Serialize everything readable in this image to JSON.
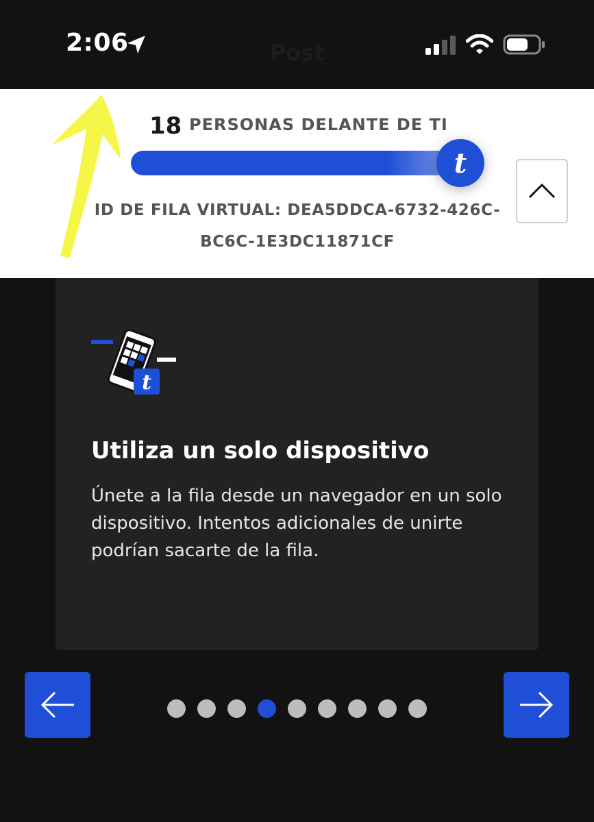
{
  "status_bar": {
    "time": "2:06",
    "ghost_title": "Post",
    "icons": [
      "location-arrow-icon",
      "cellular-signal-icon",
      "wifi-icon",
      "battery-icon"
    ]
  },
  "queue": {
    "ahead_count": "18",
    "ahead_label": "PERSONAS DELANTE DE TI",
    "progress_fraction": 0.97,
    "knob_glyph": "t",
    "id_text": "ID DE FILA VIRTUAL: DEA5DDCA-6732-426C-BC6C-1E3DC11871CF"
  },
  "card": {
    "title": "Utiliza un solo dispositivo",
    "body": "Únete a la fila desde un navegador en un solo dispositivo. Intentos adicionales de unirte podrían sacarte de la fila.",
    "illustration_badge": "t"
  },
  "pager": {
    "total": 9,
    "active_index": 3
  },
  "colors": {
    "accent": "#1f4fd6",
    "background": "#121212",
    "card": "#222222",
    "annotation": "#f5f53a"
  }
}
